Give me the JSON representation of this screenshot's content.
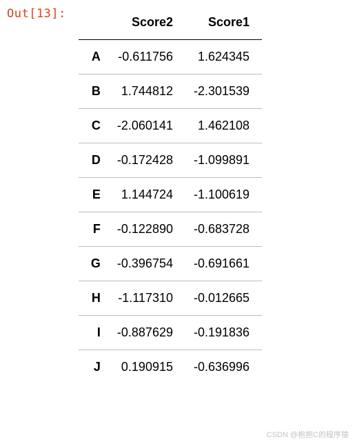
{
  "prompt": "Out[13]:",
  "table": {
    "columns": [
      "Score2",
      "Score1"
    ],
    "index": [
      "A",
      "B",
      "C",
      "D",
      "E",
      "F",
      "G",
      "H",
      "I",
      "J"
    ],
    "rows": [
      [
        "-0.611756",
        "1.624345"
      ],
      [
        "1.744812",
        "-2.301539"
      ],
      [
        "-2.060141",
        "1.462108"
      ],
      [
        "-0.172428",
        "-1.099891"
      ],
      [
        "1.144724",
        "-1.100619"
      ],
      [
        "-0.122890",
        "-0.683728"
      ],
      [
        "-0.396754",
        "-0.691661"
      ],
      [
        "-1.117310",
        "-0.012665"
      ],
      [
        "-0.887629",
        "-0.191836"
      ],
      [
        "0.190915",
        "-0.636996"
      ]
    ]
  },
  "watermark": "CSDN @抱抱C的程序猿"
}
